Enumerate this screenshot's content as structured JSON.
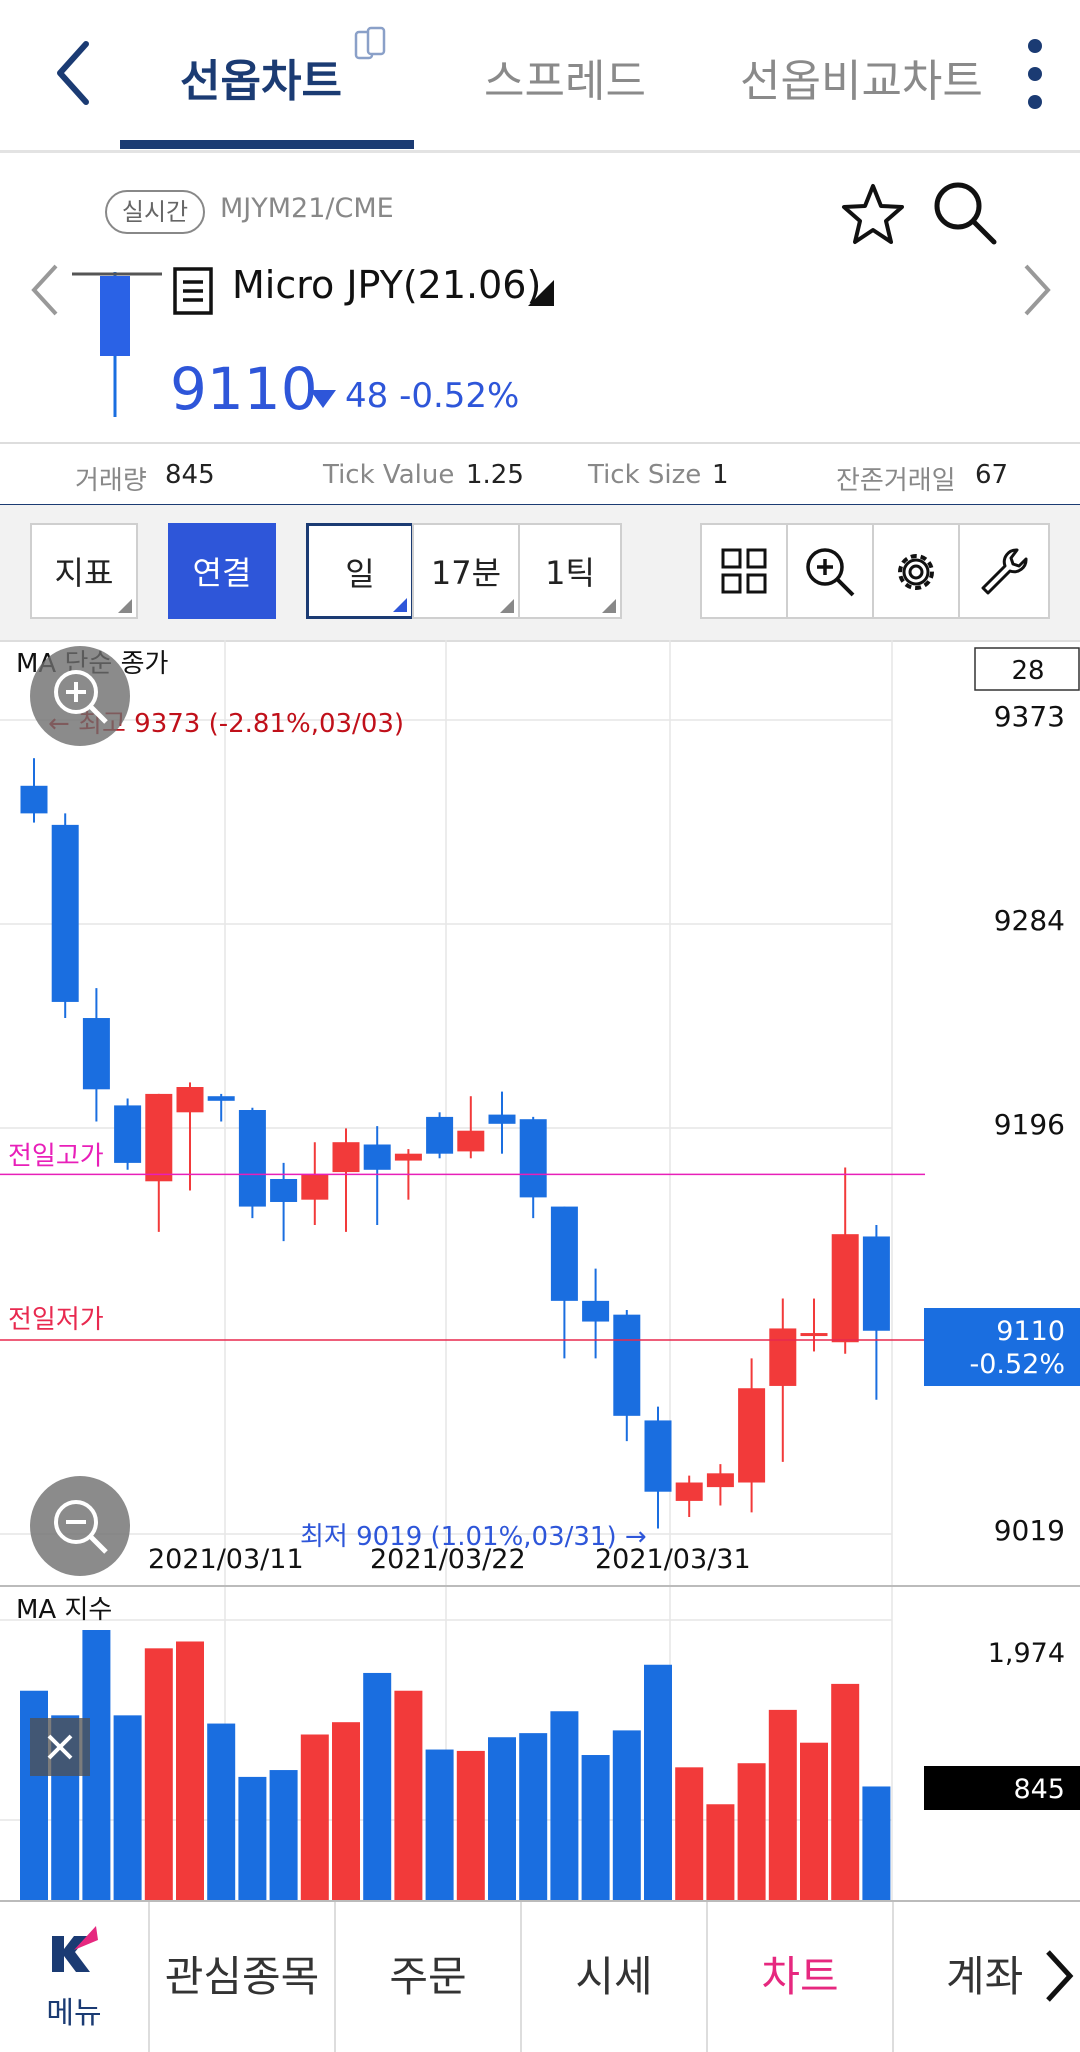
{
  "header": {
    "tabs": [
      {
        "label": "선옵차트",
        "active": true
      },
      {
        "label": "스프레드",
        "active": false
      },
      {
        "label": "선옵비교차트",
        "active": false
      }
    ]
  },
  "instrument": {
    "badge": "실시간",
    "code": "MJYM21/CME",
    "name": "Micro JPY(21.06)",
    "price": "9110",
    "change": "48",
    "change_pct": "-0.52%"
  },
  "stats": [
    {
      "label": "거래량",
      "value": "845"
    },
    {
      "label": "Tick Value",
      "value": "1.25"
    },
    {
      "label": "Tick Size",
      "value": "1"
    },
    {
      "label": "잔존거래일",
      "value": "67"
    }
  ],
  "toolbar": {
    "indicator": "지표",
    "connect": "연결",
    "period_day": "일",
    "period_min": "17분",
    "period_tick": "1틱"
  },
  "chart_data": {
    "type": "candlestick",
    "main_label": "MA 단순 종가",
    "sub_label": "MA 지수",
    "period_box": "28",
    "y_ticks": [
      "9373",
      "9284",
      "9196",
      "9019"
    ],
    "ylim": [
      9019,
      9373
    ],
    "x_ticks": [
      "2021/03/11",
      "2021/03/22",
      "2021/03/31"
    ],
    "annotation_high": "← 최고 9373 (-2.81%,03/03)",
    "annotation_low": "최저 9019 (1.01%,03/31) →",
    "prev_high_label": "전일고가",
    "prev_high_value": 9178,
    "prev_low_label": "전일저가",
    "prev_low_value": 9106,
    "current_label_price": "9110",
    "current_label_pct": "-0.52%",
    "volume_max_label": "1,974",
    "volume_current_label": "845",
    "colors": {
      "up": "#f23a3a",
      "down": "#1a6ee0",
      "prev_high": "#e81fb9",
      "prev_low": "#e8294f"
    },
    "candles": [
      {
        "o": 9347,
        "h": 9359,
        "l": 9331,
        "c": 9335
      },
      {
        "o": 9330,
        "h": 9335,
        "l": 9246,
        "c": 9253
      },
      {
        "o": 9246,
        "h": 9259,
        "l": 9201,
        "c": 9215
      },
      {
        "o": 9208,
        "h": 9211,
        "l": 9180,
        "c": 9183
      },
      {
        "o": 9175,
        "h": 9198,
        "l": 9153,
        "c": 9213
      },
      {
        "o": 9205,
        "h": 9218,
        "l": 9171,
        "c": 9216
      },
      {
        "o": 9212,
        "h": 9213,
        "l": 9201,
        "c": 9210
      },
      {
        "o": 9206,
        "h": 9207,
        "l": 9159,
        "c": 9164
      },
      {
        "o": 9176,
        "h": 9183,
        "l": 9149,
        "c": 9166
      },
      {
        "o": 9167,
        "h": 9192,
        "l": 9156,
        "c": 9178
      },
      {
        "o": 9179,
        "h": 9198,
        "l": 9153,
        "c": 9192
      },
      {
        "o": 9191,
        "h": 9199,
        "l": 9156,
        "c": 9180
      },
      {
        "o": 9184,
        "h": 9189,
        "l": 9167,
        "c": 9187
      },
      {
        "o": 9203,
        "h": 9205,
        "l": 9185,
        "c": 9187
      },
      {
        "o": 9188,
        "h": 9212,
        "l": 9185,
        "c": 9197
      },
      {
        "o": 9204,
        "h": 9214,
        "l": 9187,
        "c": 9200
      },
      {
        "o": 9202,
        "h": 9203,
        "l": 9159,
        "c": 9168
      },
      {
        "o": 9164,
        "h": 9160,
        "l": 9098,
        "c": 9123
      },
      {
        "o": 9123,
        "h": 9137,
        "l": 9098,
        "c": 9114
      },
      {
        "o": 9117,
        "h": 9119,
        "l": 9062,
        "c": 9073
      },
      {
        "o": 9071,
        "h": 9077,
        "l": 9024,
        "c": 9040
      },
      {
        "o": 9036,
        "h": 9047,
        "l": 9029,
        "c": 9044
      },
      {
        "o": 9042,
        "h": 9052,
        "l": 9034,
        "c": 9048
      },
      {
        "o": 9044,
        "h": 9098,
        "l": 9031,
        "c": 9085
      },
      {
        "o": 9086,
        "h": 9124,
        "l": 9053,
        "c": 9111
      },
      {
        "o": 9109,
        "h": 9124,
        "l": 9101,
        "c": 9109
      },
      {
        "o": 9105,
        "h": 9181,
        "l": 9100,
        "c": 9152
      },
      {
        "o": 9151,
        "h": 9156,
        "l": 9080,
        "c": 9110
      }
    ],
    "volumes": [
      1530,
      1350,
      1974,
      1350,
      1840,
      1890,
      1290,
      900,
      950,
      1210,
      1300,
      1660,
      1530,
      1100,
      1090,
      1190,
      1220,
      1380,
      1060,
      1240,
      1720,
      970,
      700,
      1000,
      1390,
      1150,
      1580,
      830
    ]
  },
  "bottom_nav": {
    "menu_label": "메뉴",
    "items": [
      "관심종목",
      "주문",
      "시세",
      "차트",
      "계좌"
    ]
  }
}
